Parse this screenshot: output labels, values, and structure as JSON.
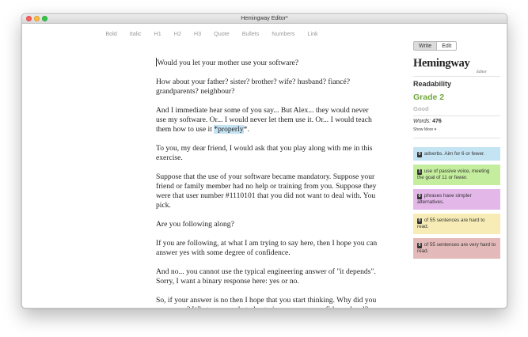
{
  "window": {
    "title": "Hemingway Editor*"
  },
  "toolbar": {
    "items": [
      "Bold",
      "Italic",
      "H1",
      "H2",
      "H3",
      "Quote",
      "Bullets",
      "Numbers",
      "Link"
    ]
  },
  "document": {
    "p1": "Would you let your mother use your software?",
    "p2": "How about your father? sister? brother? wife? husband? fiancé? grandparents? neighbour?",
    "p3_before": "And I immediate hear some of you say... But Alex... they would never use my software. Or... I would never let them use it. Or... I would teach them how to use it ",
    "p3_highlight": "*properly",
    "p3_after": "*.",
    "p4": "To you, my dear friend, I would ask that you play along with me in this exercise.",
    "p5": "Suppose that the use of your software became mandatory. Suppose your friend or family member had no help or training from you. Suppose they were that user number #1110101 that you did not want to deal with. You pick.",
    "p6": "Are you following along?",
    "p7": "If you are following, at what I am trying to say here, then I hope you can answer yes with some degree of confidence.",
    "p8": "And no... you cannot use the typical engineering answer of \"it depends\". Sorry, I want a binary response here: yes or no.",
    "p9": "So, if your answer is no then I hope that you start thinking. Why did you answer no? What can you do today to increase your confidence level? Because you can."
  },
  "sidebar": {
    "mode_write": "Write",
    "mode_edit": "Edit",
    "logo": "Hemingway",
    "logo_sub": "Editor",
    "readability_label": "Readability",
    "grade": "Grade 2",
    "grade_word": "Good",
    "words_label": "Words:",
    "words_count": "476",
    "show_more": "Show More ▾",
    "cards": {
      "adverbs": {
        "count": "0",
        "text": "adverbs. Aim for 6 or fewer."
      },
      "passive": {
        "count": "1",
        "text": "use of passive voice, meeting the goal of 11 or fewer."
      },
      "phrases": {
        "count": "0",
        "text": "phrases have simpler alternatives."
      },
      "hard": {
        "count": "0",
        "text": "of 55 sentences are hard to read."
      },
      "very_hard": {
        "count": "0",
        "text": "of 55 sentences are very hard to read."
      }
    }
  },
  "colors": {
    "adverbs": "#c4e3f3",
    "passive": "#c4ed9d",
    "phrases": "#e3b7e8",
    "hard": "#f7ecb5",
    "very_hard": "#e4b9b9",
    "grade": "#6fa83c"
  }
}
